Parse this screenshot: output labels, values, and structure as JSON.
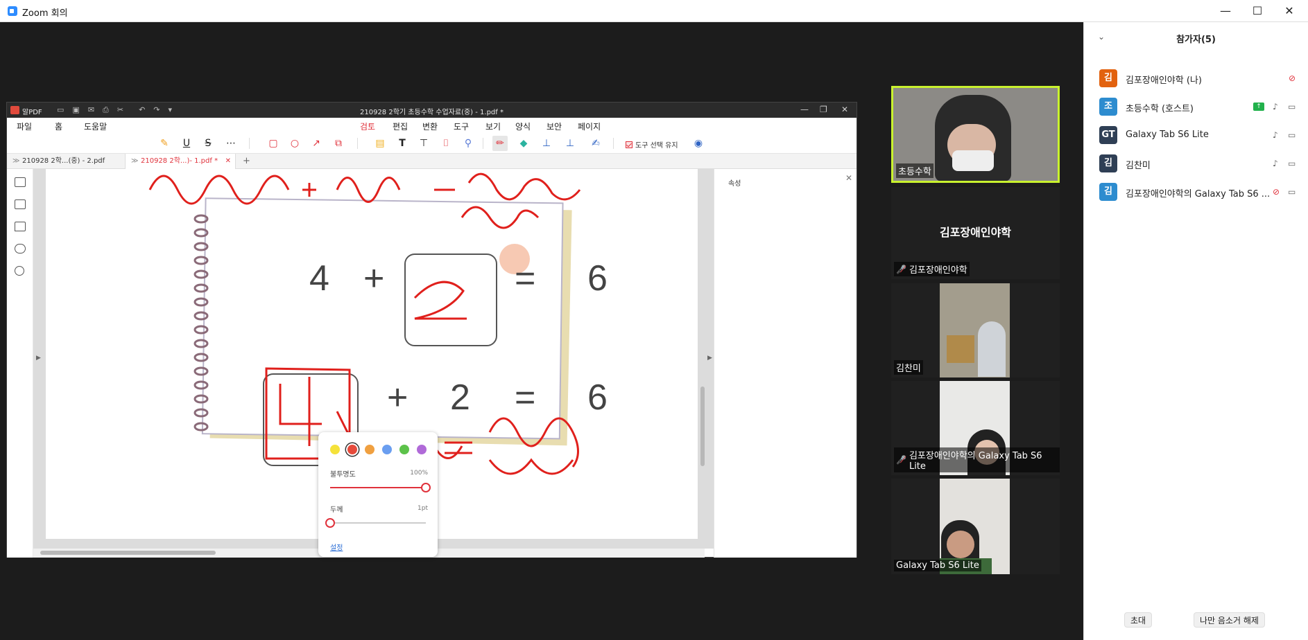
{
  "zoom": {
    "title": "Zoom 회의",
    "minimize": "—",
    "maximize": "☐",
    "close": "✕"
  },
  "pdf": {
    "app_name": "알PDF",
    "doc_title": "210928 2학기 초등수학 수업자료(중) - 1.pdf *",
    "menus": [
      "파일",
      "홈",
      "도움말",
      "검토",
      "편집",
      "변환",
      "도구",
      "보기",
      "양식",
      "보안",
      "페이지"
    ],
    "active_menu": "검토",
    "keep_tool_label": "도구 선택 유지",
    "tabs": [
      {
        "label": "210928 2학...(중) - 2.pdf"
      },
      {
        "label": "210928 2학...)- 1.pdf *"
      }
    ],
    "properties_title": "속성",
    "page": {
      "eq1": {
        "a": "4",
        "op": "+",
        "b": "2",
        "eq": "=",
        "c": "6"
      },
      "eq2": {
        "a": "4",
        "op": "+",
        "b": "2",
        "eq": "=",
        "c": "6"
      }
    },
    "color_popup": {
      "swatches": [
        "#f5e23a",
        "#e64a3b",
        "#f0a040",
        "#6a9ef0",
        "#5cc24a",
        "#b06ad8"
      ],
      "selected_index": 1,
      "opacity_label": "불투명도",
      "opacity_value": "100%",
      "opacity_fraction": 1.0,
      "thickness_label": "두께",
      "thickness_value": "1pt",
      "thickness_fraction": 0.0,
      "settings_link": "설정"
    }
  },
  "gallery": [
    {
      "name": "초등수학",
      "muted": false
    },
    {
      "name": "김포장애인야학",
      "center": "김포장애인야학",
      "muted": true
    },
    {
      "name": "김찬미",
      "muted": false
    },
    {
      "name": "김포장애인야학의 Galaxy Tab S6 Lite",
      "muted": true
    },
    {
      "name": "Galaxy Tab S6 Lite",
      "muted": false
    }
  ],
  "participants_panel": {
    "title": "참가자(5)",
    "participants": [
      {
        "initial": "김",
        "name": "김포장애인야학 (나)",
        "color": "#e2620f",
        "mic": "muted",
        "video": "none"
      },
      {
        "initial": "조",
        "name": "초등수학 (호스트)",
        "color": "#2d8ccf",
        "mic": "on",
        "video": "on",
        "sharing": true
      },
      {
        "initial": "GT",
        "name": "Galaxy Tab S6 Lite",
        "color": "#2f3f55",
        "mic": "on",
        "video": "on"
      },
      {
        "initial": "김",
        "name": "김찬미",
        "color": "#2f3f55",
        "mic": "on",
        "video": "on"
      },
      {
        "initial": "김",
        "name": "김포장애인야학의 Galaxy Tab S6 ...",
        "color": "#2d8ccf",
        "mic": "muted",
        "video": "on"
      }
    ],
    "invite_button": "초대",
    "unmute_self_button": "나만 음소거 해제"
  }
}
